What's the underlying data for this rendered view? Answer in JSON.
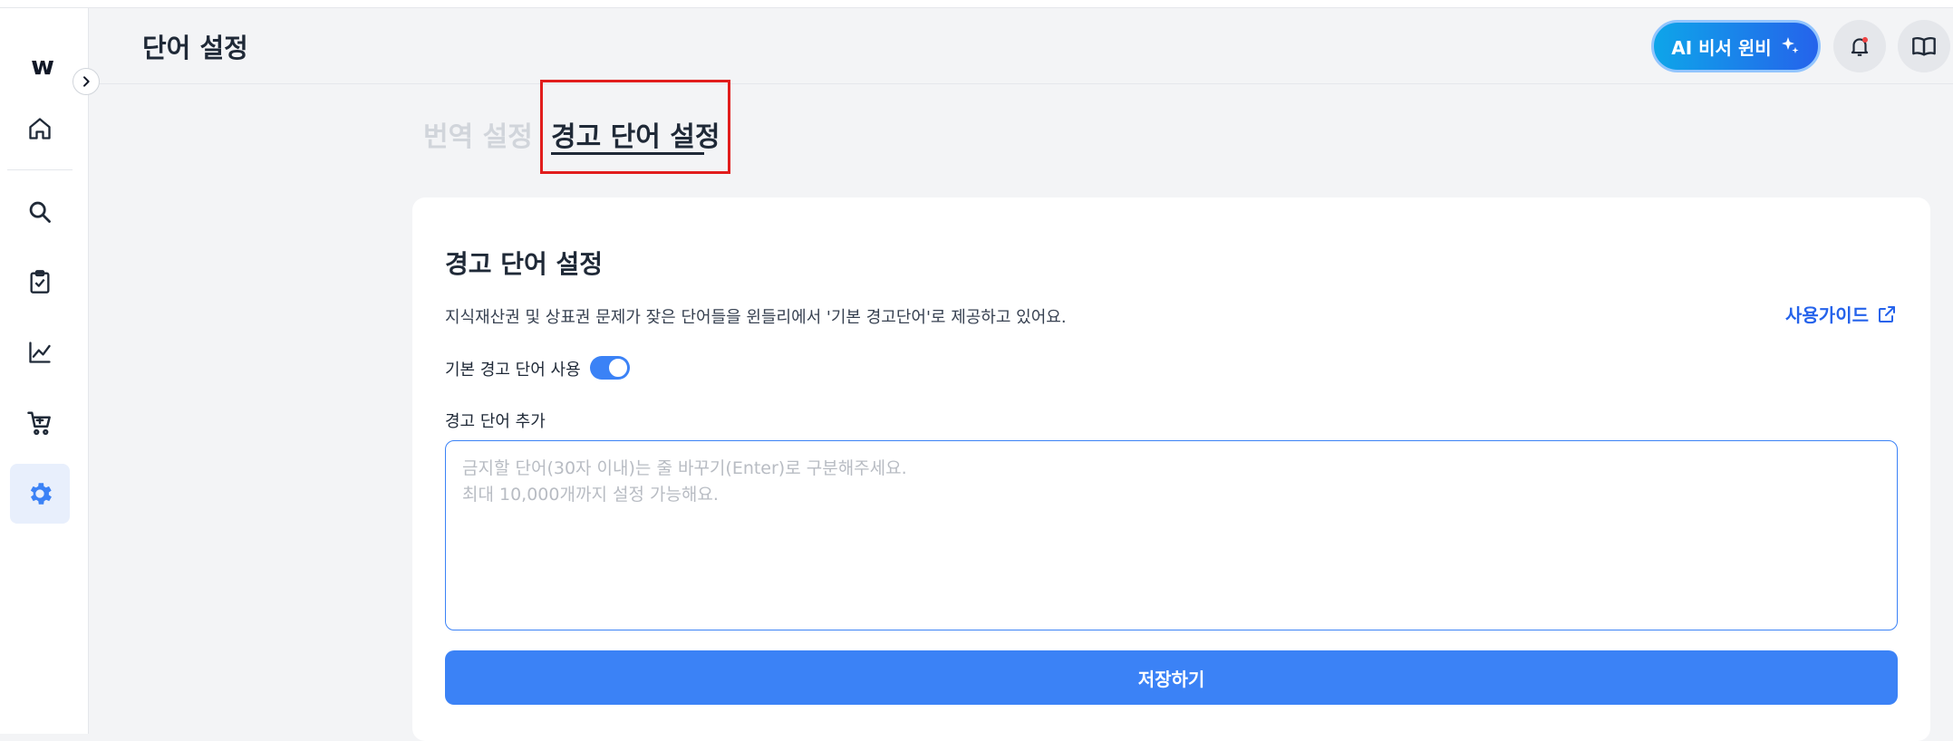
{
  "sidebar": {
    "logo": "w",
    "items": [
      {
        "name": "home",
        "icon": "home-icon",
        "active": false
      },
      {
        "name": "search",
        "icon": "search-icon",
        "active": false
      },
      {
        "name": "tasks",
        "icon": "clipboard-check-icon",
        "active": false
      },
      {
        "name": "analytics",
        "icon": "chart-line-icon",
        "active": false
      },
      {
        "name": "shop",
        "icon": "cart-icon",
        "active": false
      },
      {
        "name": "settings",
        "icon": "gear-icon",
        "active": true
      }
    ]
  },
  "header": {
    "title": "단어 설정",
    "ai_button_label": "AI 비서 윈비",
    "notification_icon": "bell-icon",
    "guide_icon": "book-icon"
  },
  "tabs": [
    {
      "label": "번역 설정",
      "active": false
    },
    {
      "label": "경고 단어 설정",
      "active": true
    }
  ],
  "card": {
    "title": "경고 단어 설정",
    "description": "지식재산권 및 상표권 문제가 잦은 단어들을 윈들리에서 '기본 경고단어'로 제공하고 있어요.",
    "guide_link": "사용가이드",
    "toggle_label": "기본 경고 단어 사용",
    "toggle_on": true,
    "field_label": "경고 단어 추가",
    "placeholder": "금지할 단어(30자 이내)는 줄 바꾸기(Enter)로 구분해주세요.\n최대 10,000개까지 설정 가능해요.",
    "save_label": "저장하기"
  },
  "colors": {
    "accent": "#3b82f6",
    "highlight_box": "#e11d1d"
  }
}
